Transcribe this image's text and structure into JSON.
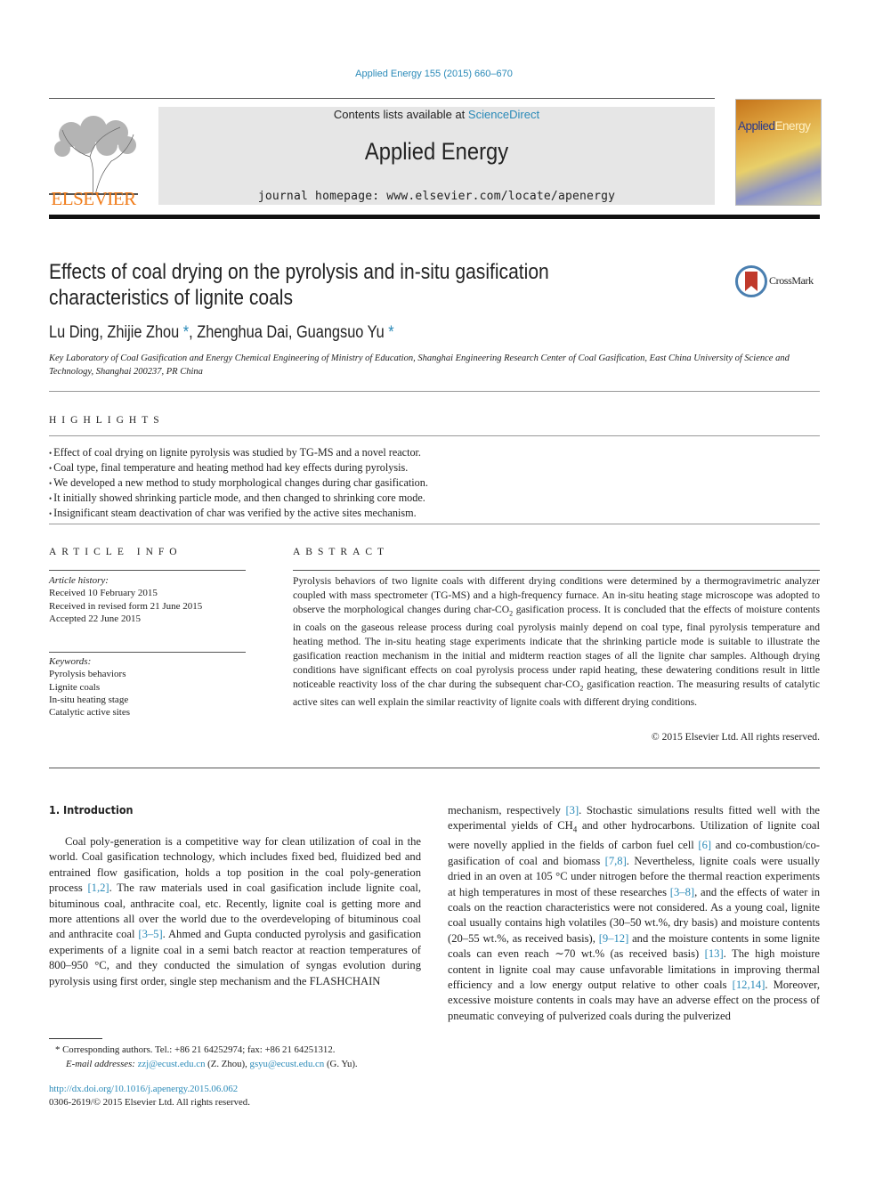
{
  "header": {
    "citation": "Applied Energy 155 (2015) 660–670",
    "contents_prefix": "Contents lists available at ",
    "contents_link": "ScienceDirect",
    "journal_title": "Applied Energy",
    "homepage": "journal homepage: www.elsevier.com/locate/apenergy",
    "publisher_logo_text": "ELSEVIER",
    "cover_title_a": "Applied",
    "cover_title_b": "Energy"
  },
  "article": {
    "title": "Effects of coal drying on the pyrolysis and in-situ gasification characteristics of lignite coals",
    "crossmark_label": "CrossMark",
    "authors": [
      {
        "name": "Lu Ding",
        "corresponding": false
      },
      {
        "name": "Zhijie Zhou",
        "corresponding": true
      },
      {
        "name": "Zhenghua Dai",
        "corresponding": false
      },
      {
        "name": "Guangsuo Yu",
        "corresponding": true
      }
    ],
    "authors_text_1": "Lu Ding, Zhijie Zhou",
    "authors_text_2": ", Zhenghua Dai, Guangsuo Yu",
    "affiliation": "Key Laboratory of Coal Gasification and Energy Chemical Engineering of Ministry of Education, Shanghai Engineering Research Center of Coal Gasification, East China University of Science and Technology, Shanghai 200237, PR China"
  },
  "highlights": {
    "heading": "HIGHLIGHTS",
    "items": [
      "Effect of coal drying on lignite pyrolysis was studied by TG-MS and a novel reactor.",
      "Coal type, final temperature and heating method had key effects during pyrolysis.",
      "We developed a new method to study morphological changes during char gasification.",
      "It initially showed shrinking particle mode, and then changed to shrinking core mode.",
      "Insignificant steam deactivation of char was verified by the active sites mechanism."
    ]
  },
  "article_info": {
    "heading": "ARTICLE INFO",
    "history_label": "Article history:",
    "history": [
      "Received 10 February 2015",
      "Received in revised form 21 June 2015",
      "Accepted 22 June 2015"
    ],
    "keywords_label": "Keywords:",
    "keywords": [
      "Pyrolysis behaviors",
      "Lignite coals",
      "In-situ heating stage",
      "Catalytic active sites"
    ]
  },
  "abstract": {
    "heading": "ABSTRACT",
    "p1": "Pyrolysis behaviors of two lignite coals with different drying conditions were determined by a thermogravimetric analyzer coupled with mass spectrometer (TG-MS) and a high-frequency furnace. An in-situ heating stage microscope was adopted to observe the morphological changes during char-CO",
    "p2": " gasification process. It is concluded that the effects of moisture contents in coals on the gaseous release process during coal pyrolysis mainly depend on coal type, final pyrolysis temperature and heating method. The in-situ heating stage experiments indicate that the shrinking particle mode is suitable to illustrate the gasification reaction mechanism in the initial and midterm reaction stages of all the lignite char samples. Although drying conditions have significant effects on coal pyrolysis process under rapid heating, these dewatering conditions result in little noticeable reactivity loss of the char during the subsequent char-CO",
    "p3": " gasification reaction. The measuring results of catalytic active sites can well explain the similar reactivity of lignite coals with different drying conditions.",
    "sub2": "2",
    "copyright": "© 2015 Elsevier Ltd. All rights reserved."
  },
  "intro": {
    "heading": "1. Introduction",
    "left": [
      "Coal poly-generation is a competitive way for clean utilization of coal in the world. Coal gasification technology, which includes fixed bed, fluidized bed and entrained flow gasification, holds a top position in the coal poly-generation process ",
      "[1,2]",
      ". The raw materials used in coal gasification include lignite coal, bituminous coal, anthracite coal, etc. Recently, lignite coal is getting more and more attentions all over the world due to the overdeveloping of bituminous coal and anthracite coal ",
      "[3–5]",
      ". Ahmed and Gupta conducted pyrolysis and gasification experiments of a lignite coal in a semi batch reactor at reaction temperatures of 800–950 °C, and they conducted the simulation of syngas evolution during pyrolysis using first order, single step mechanism and the FLASHCHAIN"
    ],
    "right": [
      "mechanism, respectively ",
      "[3]",
      ". Stochastic simulations results fitted well with the experimental yields of CH",
      "4",
      " and other hydrocarbons. Utilization of lignite coal were novelly applied in the fields of carbon fuel cell ",
      "[6]",
      " and co-combustion/co-gasification of coal and biomass ",
      "[7,8]",
      ". Nevertheless, lignite coals were usually dried in an oven at 105 °C under nitrogen before the thermal reaction experiments at high temperatures in most of these researches ",
      "[3–8]",
      ", and the effects of water in coals on the reaction characteristics were not considered. As a young coal, lignite coal usually contains high volatiles (30–50 wt.%, dry basis) and moisture contents (20–55 wt.%, as received basis), ",
      "[9–12]",
      " and the moisture contents in some lignite coals can even reach ∼70 wt.% (as received basis) ",
      "[13]",
      ". The high moisture content in lignite coal may cause unfavorable limitations in improving thermal efficiency and a low energy output relative to other coals ",
      "[12,14]",
      ". Moreover, excessive moisture contents in coals may have an adverse effect on the process of pneumatic conveying of pulverized coals during the pulverized"
    ]
  },
  "footnote": {
    "line1": "Corresponding authors. Tel.: +86 21 64252974; fax: +86 21 64251312.",
    "email_label": "E-mail addresses: ",
    "email1": "zzj@ecust.edu.cn",
    "email1_who": " (Z. Zhou), ",
    "email2": "gsyu@ecust.edu.cn",
    "email2_who": " (G. Yu).",
    "star": "*"
  },
  "doi": {
    "link": "http://dx.doi.org/10.1016/j.apenergy.2015.06.062",
    "issn_line": "0306-2619/© 2015 Elsevier Ltd. All rights reserved."
  },
  "colors": {
    "link": "#2a8ab8",
    "elsevier_orange": "#f07c1a",
    "journal_box": "#e6e6e6"
  }
}
